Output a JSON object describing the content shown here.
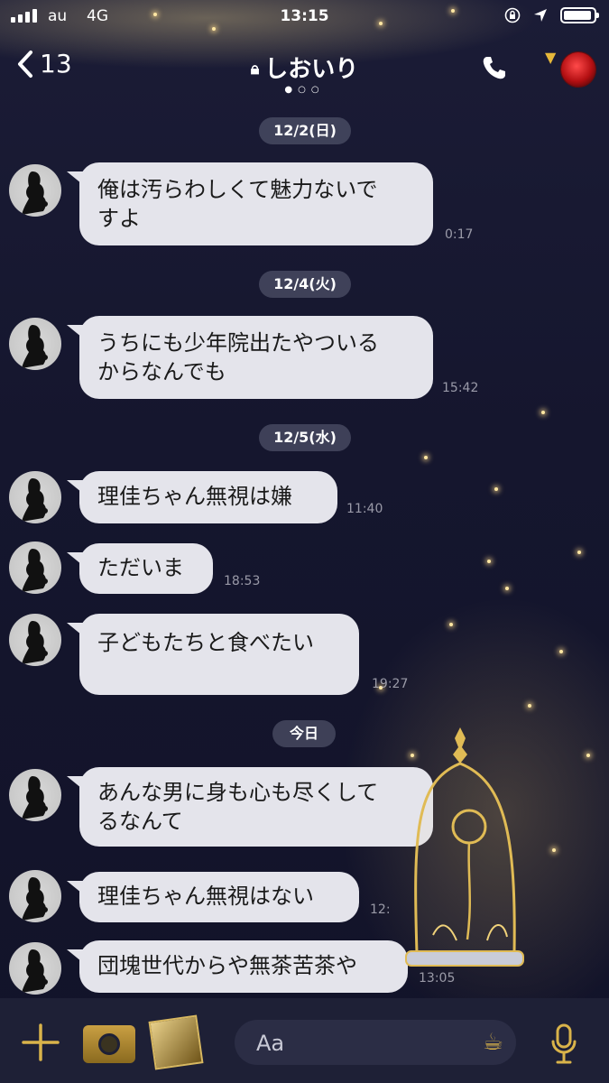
{
  "status_bar": {
    "carrier": "au",
    "network": "4G",
    "time": "13:15"
  },
  "header": {
    "back_count": "13",
    "title": "しおいり",
    "page_dots": "●○○"
  },
  "icons": [
    "signal-icon",
    "lock-icon",
    "location-icon",
    "battery-icon",
    "back-chevron-icon",
    "call-icon",
    "chevron-down-icon",
    "rose-icon",
    "plus-icon",
    "camera-icon",
    "photo-icon",
    "teapot-icon",
    "mic-icon"
  ],
  "colors": {
    "accent_gold": "#e7b83a",
    "bubble": "#e4e4eb",
    "background": "#15162f"
  },
  "dates": [
    "12/2(日)",
    "12/4(火)",
    "12/5(水)",
    "今日"
  ],
  "messages": [
    {
      "text_lines": [
        "俺は汚らわしくて魅力ないで",
        "すよ"
      ],
      "time": "0:17"
    },
    {
      "text_lines": [
        "うちにも少年院出たやついる",
        "からなんでも"
      ],
      "time": "15:42"
    },
    {
      "text_lines": [
        "理佳ちゃん無視は嫌"
      ],
      "time": "11:40"
    },
    {
      "text_lines": [
        "ただいま"
      ],
      "time": "18:53"
    },
    {
      "text_lines": [
        "子どもたちと食べたい"
      ],
      "time": "19:27"
    },
    {
      "text_lines": [
        "あんな男に身も心も尽くして",
        "るなんて"
      ],
      "time": ""
    },
    {
      "text_lines": [
        "理佳ちゃん無視はない"
      ],
      "time": "12:"
    },
    {
      "text_lines": [
        "団塊世代からや無茶苦茶や"
      ],
      "time": "13:05"
    }
  ],
  "input": {
    "placeholder": "Aa"
  }
}
